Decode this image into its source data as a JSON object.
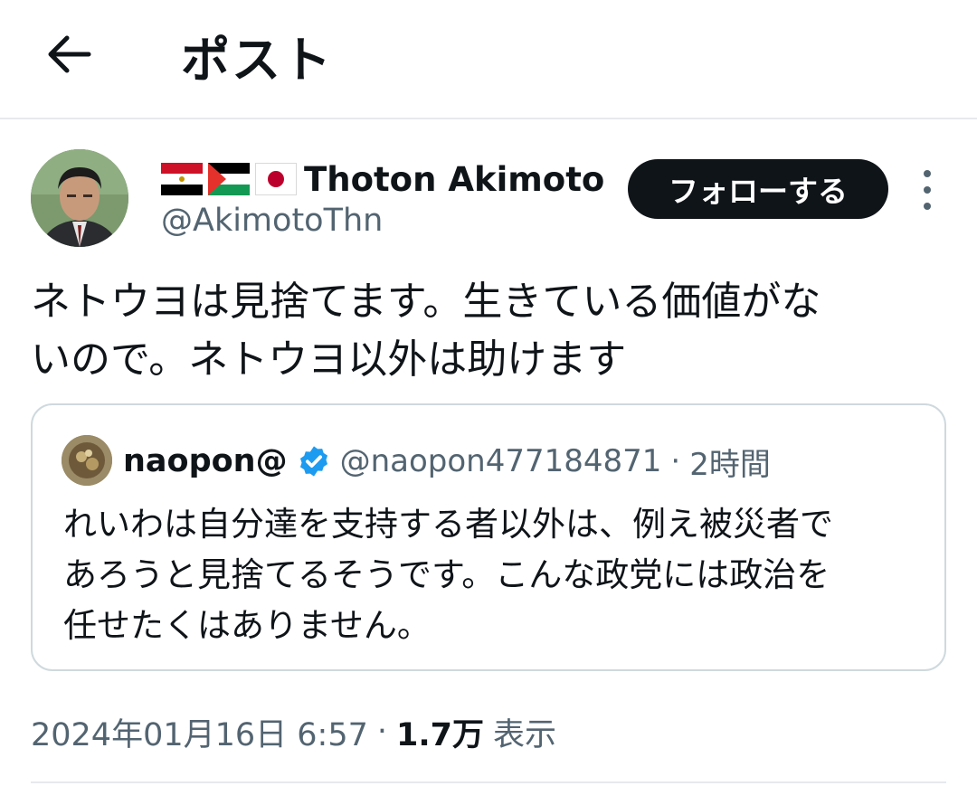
{
  "header": {
    "title": "ポスト",
    "back_icon": "arrow-left-icon"
  },
  "post": {
    "author": {
      "flags": [
        "egypt-flag-icon",
        "palestine-flag-icon",
        "japan-flag-icon"
      ],
      "display_name": "Thoton Akimoto",
      "handle": "@AkimotoThn"
    },
    "follow_label": "フォローする",
    "more_icon": "more-vertical-icon",
    "text": "ネトウヨは見捨てます。生きている価値がな\nいので。ネトウヨ以外は助けます",
    "quote": {
      "author_name": "naopon@",
      "verified_icon": "verified-badge-icon",
      "handle": "@naopon477184871",
      "separator": "·",
      "time": "2時間",
      "text": "れいわは自分達を支持する者以外は、例え被災者で\nあろうと見捨てるそうです。こんな政党には政治を\n任せたくはありません。"
    },
    "meta": {
      "timestamp": "2024年01月16日 6:57",
      "separator": "·",
      "views_count": "1.7万",
      "views_label": "表示"
    }
  },
  "colors": {
    "text_primary": "#0f1419",
    "text_secondary": "#536471",
    "border": "#cfd9de",
    "verified": "#1d9bf0",
    "follow_button_bg": "#0f1419"
  }
}
